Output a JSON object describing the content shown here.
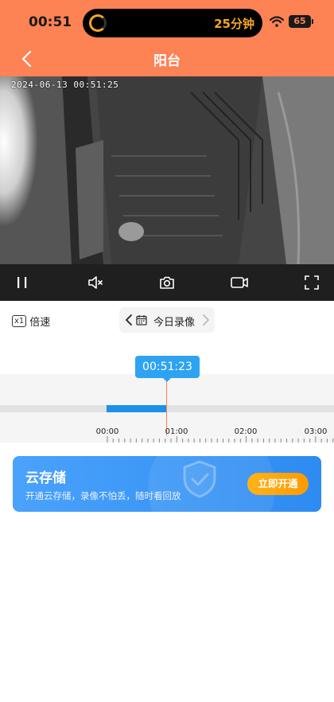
{
  "status_bar": {
    "time": "00:51",
    "island_text": "25分钟",
    "battery": "65",
    "wifi_icon": "wifi-icon"
  },
  "nav": {
    "title": "阳台",
    "back_icon": "chevron-left-icon"
  },
  "video": {
    "timestamp": "2024-06-13  00:51:25"
  },
  "controls": {
    "icons": [
      "pause-icon",
      "mute-icon",
      "camera-icon",
      "video-record-icon",
      "fullscreen-icon"
    ]
  },
  "playback": {
    "speed_badge": "x1",
    "speed_label": "倍速",
    "date_label": "今日录像"
  },
  "timeline": {
    "current_time": "00:51:23",
    "tick_labels": [
      "00:00",
      "01:00",
      "02:00",
      "03:00"
    ],
    "recorded_range": [
      "00:00",
      "00:51"
    ]
  },
  "cloud_banner": {
    "title": "云存储",
    "subtitle": "开通云存储，录像不怕丢，随时看回放",
    "button": "立即开通"
  },
  "colors": {
    "header": "#fd8254",
    "accent_blue": "#2ea3f2",
    "cursor": "#ff7f4e",
    "button_orange": "#ff9900"
  }
}
